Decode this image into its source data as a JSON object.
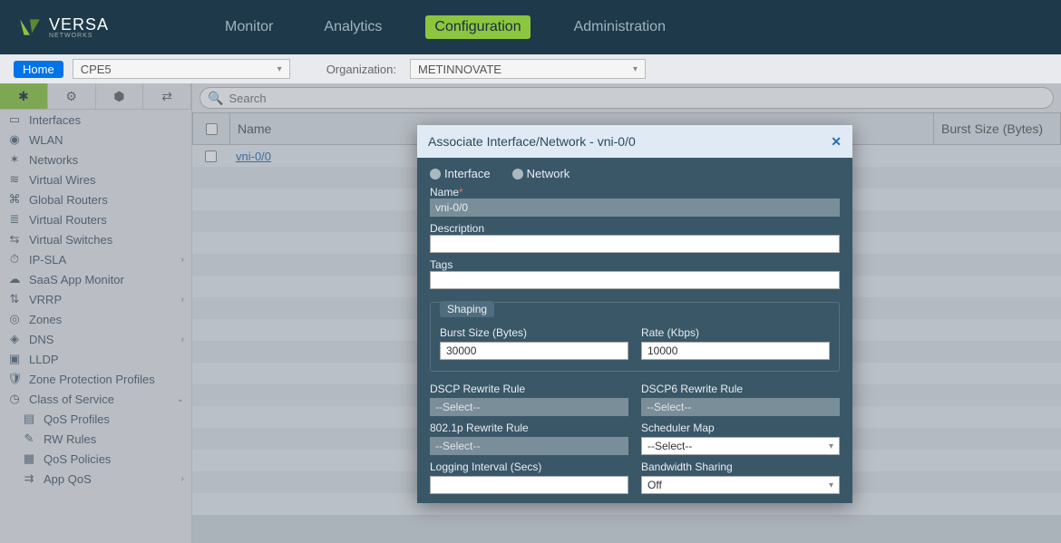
{
  "header": {
    "brand": "VERSA",
    "brand_sub": "NETWORKS",
    "nav": {
      "monitor": "Monitor",
      "analytics": "Analytics",
      "configuration": "Configuration",
      "administration": "Administration"
    }
  },
  "secbar": {
    "home": "Home",
    "device": "CPE5",
    "org_label": "Organization:",
    "org_value": "METINNOVATE"
  },
  "search": {
    "placeholder": "Search"
  },
  "sidebar": {
    "items": [
      {
        "label": "Interfaces"
      },
      {
        "label": "WLAN"
      },
      {
        "label": "Networks"
      },
      {
        "label": "Virtual Wires"
      },
      {
        "label": "Global Routers"
      },
      {
        "label": "Virtual Routers"
      },
      {
        "label": "Virtual Switches"
      },
      {
        "label": "IP-SLA",
        "chev": true
      },
      {
        "label": "SaaS App Monitor"
      },
      {
        "label": "VRRP",
        "chev": true
      },
      {
        "label": "Zones"
      },
      {
        "label": "DNS",
        "chev": true
      },
      {
        "label": "LLDP"
      },
      {
        "label": "Zone Protection Profiles"
      },
      {
        "label": "Class of Service",
        "expanded": true
      },
      {
        "label": "QoS Profiles",
        "sub": true
      },
      {
        "label": "RW Rules",
        "sub": true
      },
      {
        "label": "QoS Policies",
        "sub": true
      },
      {
        "label": "App QoS",
        "sub": true,
        "chev": true
      }
    ]
  },
  "table": {
    "col_name": "Name",
    "col_burst": "Burst Size (Bytes)",
    "row0_name": "vni-0/0"
  },
  "modal": {
    "title": "Associate Interface/Network - vni-0/0",
    "radio_interface": "Interface",
    "radio_network": "Network",
    "name_label": "Name",
    "name_value": "vni-0/0",
    "desc_label": "Description",
    "tags_label": "Tags",
    "shaping_legend": "Shaping",
    "burst_label": "Burst Size (Bytes)",
    "burst_value": "30000",
    "rate_label": "Rate (Kbps)",
    "rate_value": "10000",
    "dscp_label": "DSCP Rewrite Rule",
    "dscp6_label": "DSCP6 Rewrite Rule",
    "p8021_label": "802.1p Rewrite Rule",
    "schedmap_label": "Scheduler Map",
    "loginterval_label": "Logging Interval (Secs)",
    "bwshare_label": "Bandwidth Sharing",
    "select_placeholder": "--Select--",
    "bwshare_value": "Off"
  }
}
